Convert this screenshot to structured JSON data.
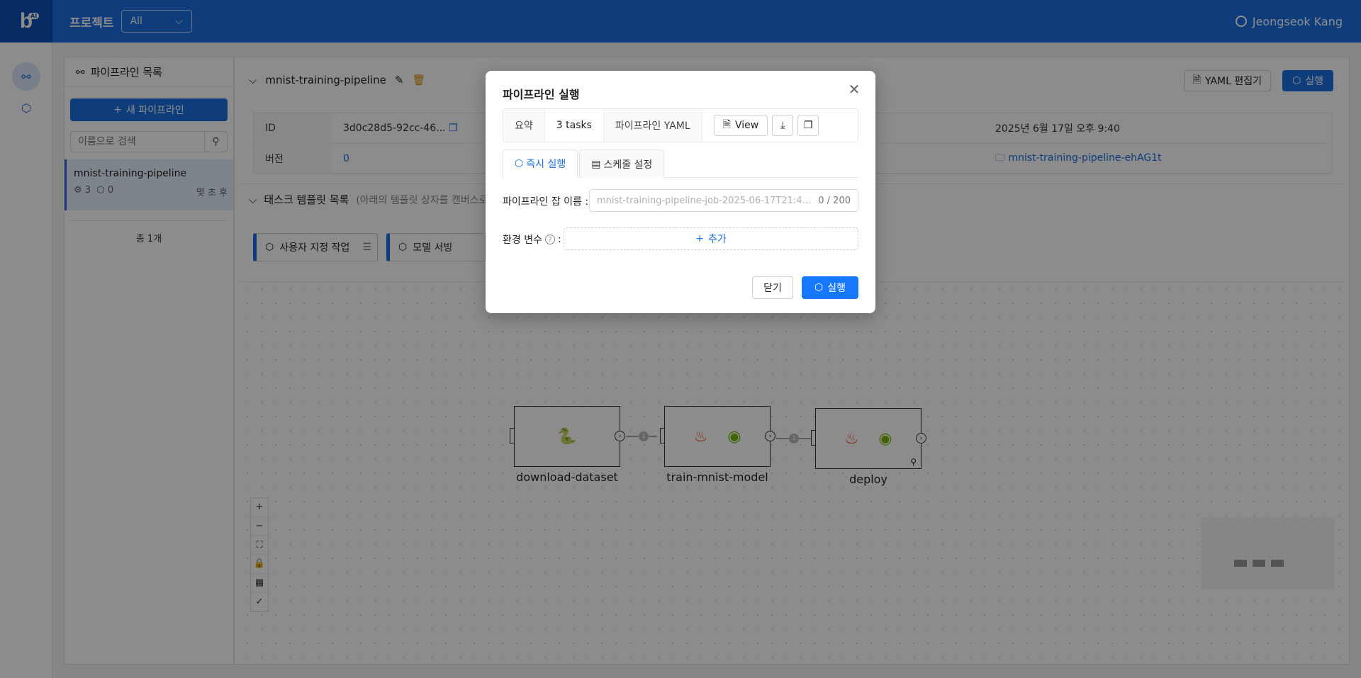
{
  "topbar": {
    "logo_text": "b",
    "logo_badge": "AI",
    "project_label": "프로젝트",
    "project_select": "All",
    "user_name": "Jeongseok Kang",
    "brand_color": "#1c6fe0"
  },
  "sidebar": {
    "title": "파이프라인 목록",
    "new_button": "새 파이프라인",
    "search_placeholder": "이름으로 검색",
    "items": [
      {
        "name": "mnist-training-pipeline",
        "task_count": "3",
        "run_count": "0",
        "time": "몇 초 후"
      }
    ],
    "total": "총 1개"
  },
  "pipeline": {
    "name": "mnist-training-pipeline",
    "yaml_button": "YAML 편집기",
    "run_button": "실행",
    "info": {
      "id_label": "ID",
      "id_value": "3d0c28d5-92cc-46...",
      "version_label": "버전",
      "version_value": "0",
      "created": "2025년 6월 17일 오후 9:40",
      "folder": "mnist-training-pipeline-ehAG1t"
    },
    "templates": {
      "title": "태스크 템플릿 목록",
      "hint": "(아래의 템플릿 상자를 캔버스로",
      "cards": [
        "사용자 지정 작업",
        "모델 서빙"
      ]
    },
    "nodes": [
      {
        "label": "download-dataset"
      },
      {
        "label": "train-mnist-model"
      },
      {
        "label": "deploy"
      }
    ],
    "edge_label": "1"
  },
  "modal": {
    "title": "파이프라인 실행",
    "summary_label": "요약",
    "tasks": "3 tasks",
    "yaml_label": "파이프라인 YAML",
    "view_button": "View",
    "tabs": [
      "즉시 실행",
      "스케줄 설정"
    ],
    "job_name_label": "파이프라인 잡 이름 :",
    "job_name_placeholder": "mnist-training-pipeline-job-2025-06-17T21:41:...",
    "job_name_count": "0 / 200",
    "env_label": "환경 변수",
    "env_colon": ":",
    "add_button": "추가",
    "close_button": "닫기",
    "run_button": "실행"
  }
}
